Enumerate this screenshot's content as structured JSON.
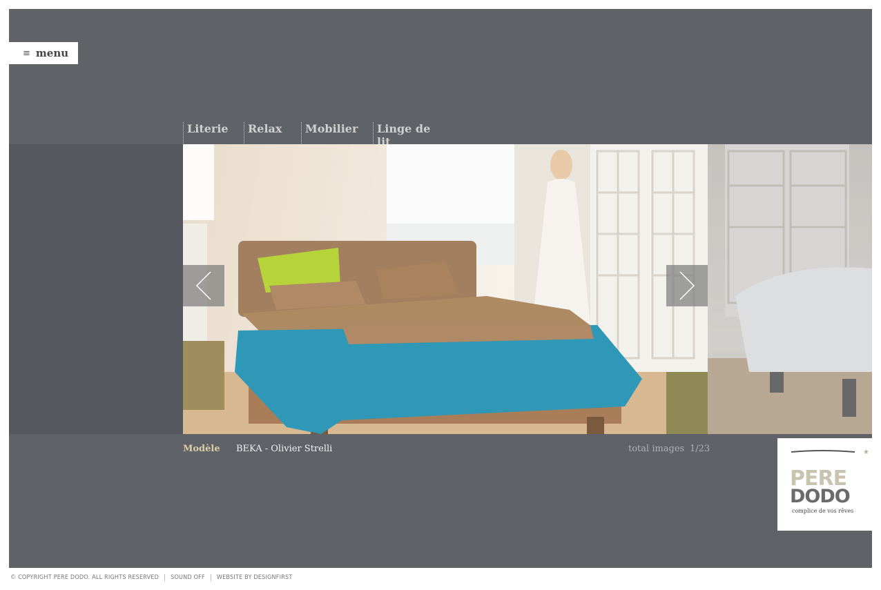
{
  "menu": {
    "icon": "list-icon",
    "label": "menu"
  },
  "nav": {
    "items": [
      {
        "label": "Literie"
      },
      {
        "label": "Relax"
      },
      {
        "label": "Mobilier"
      },
      {
        "label": "Linge de lit"
      }
    ]
  },
  "gallery": {
    "prev_icon": "chevron-left-icon",
    "next_icon": "chevron-right-icon",
    "caption_label": "Modèle",
    "caption_value": "BEKA - Olivier Strelli",
    "total_label": "total images",
    "counter": "1/23"
  },
  "logo": {
    "line1": "PERE",
    "line2": "DODO",
    "tagline": "complice de vos rêves"
  },
  "footer": {
    "copyright": "© COPYRIGHT PERE DODO. ALL RIGHTS RESERVED",
    "sound": "SOUND OFF",
    "credit": "WEBSITE BY DESIGNFIRST"
  },
  "colors": {
    "frame": "#5f6367",
    "band": "#54575d",
    "caption_label": "#d8cfa8",
    "logo_light": "#c8c3b0",
    "logo_dark": "#6b6b6b"
  }
}
